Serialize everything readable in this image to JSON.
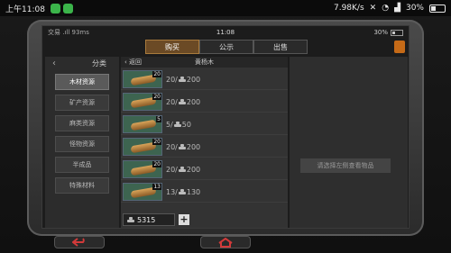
{
  "status_bar": {
    "time": "上午11:08",
    "net_speed": "7.98K/s",
    "battery": "30%"
  },
  "game_bar": {
    "left": "交易 .ıll 93ms",
    "clock": "11:08",
    "battery": "30%"
  },
  "tabs": [
    {
      "label": "购买",
      "active": true
    },
    {
      "label": "公示",
      "active": false
    },
    {
      "label": "出售",
      "active": false
    }
  ],
  "sidebar": {
    "title": "分类",
    "items": [
      "木材资源",
      "矿产资源",
      "麻类资源",
      "怪物资源",
      "半成品",
      "特殊材料"
    ],
    "active_index": 0
  },
  "list": {
    "back_label": "返回",
    "item_name": "黄杨木",
    "rows": [
      {
        "qty": "20",
        "text_a": "20/",
        "text_b": "200"
      },
      {
        "qty": "20",
        "text_a": "20/",
        "text_b": "200"
      },
      {
        "qty": "5",
        "text_a": "5/",
        "text_b": "50"
      },
      {
        "qty": "20",
        "text_a": "20/",
        "text_b": "200"
      },
      {
        "qty": "20",
        "text_a": "20/",
        "text_b": "200"
      },
      {
        "qty": "13",
        "text_a": "13/",
        "text_b": "130"
      }
    ]
  },
  "wallet": {
    "amount": "5315",
    "add_label": "+"
  },
  "detail": {
    "hint": "请选择左侧查看物品"
  },
  "colors": {
    "tab_active": "#6b4a25",
    "close_button": "#c56a17",
    "back_button": "#d23a3a",
    "home_button": "#d23a3a"
  }
}
